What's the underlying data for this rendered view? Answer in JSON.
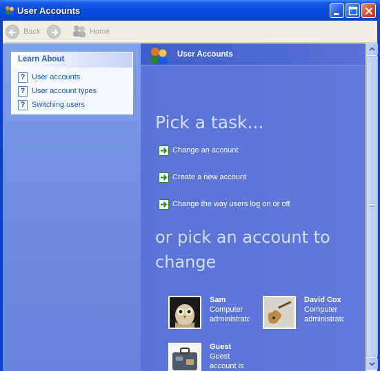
{
  "window": {
    "title": "User Accounts"
  },
  "toolbar": {
    "back_label": "Back",
    "home_label": "Home"
  },
  "learn_about": {
    "title": "Learn About",
    "items": [
      {
        "label": "User accounts",
        "icon": "help-icon"
      },
      {
        "label": "User account types",
        "icon": "help-icon"
      },
      {
        "label": "Switching users",
        "icon": "help-icon"
      }
    ]
  },
  "main": {
    "header_title": "User Accounts",
    "pick_task_title": "Pick a task...",
    "tasks": [
      {
        "label": "Change an account",
        "icon": "green-arrow-icon"
      },
      {
        "label": "Create a new account",
        "icon": "green-arrow-icon"
      },
      {
        "label": "Change the way users log on or off",
        "icon": "green-arrow-icon"
      }
    ],
    "pick_account_title": "or pick an account to change",
    "accounts": [
      {
        "name": "Sam",
        "description": "Computer administratc",
        "picture": "owl-picture"
      },
      {
        "name": "David Cox",
        "description": "Computer administratc",
        "picture": "guitar-picture"
      },
      {
        "name": "Guest",
        "description": "Guest account is off",
        "picture": "suitcase-picture"
      }
    ]
  },
  "colors": {
    "titlebar": "#0a4fe0",
    "left_pane": "#7fa2ec",
    "main_pane": "#5b74d6",
    "link": "#215dc6",
    "task_arrow": "#2b8a26"
  }
}
